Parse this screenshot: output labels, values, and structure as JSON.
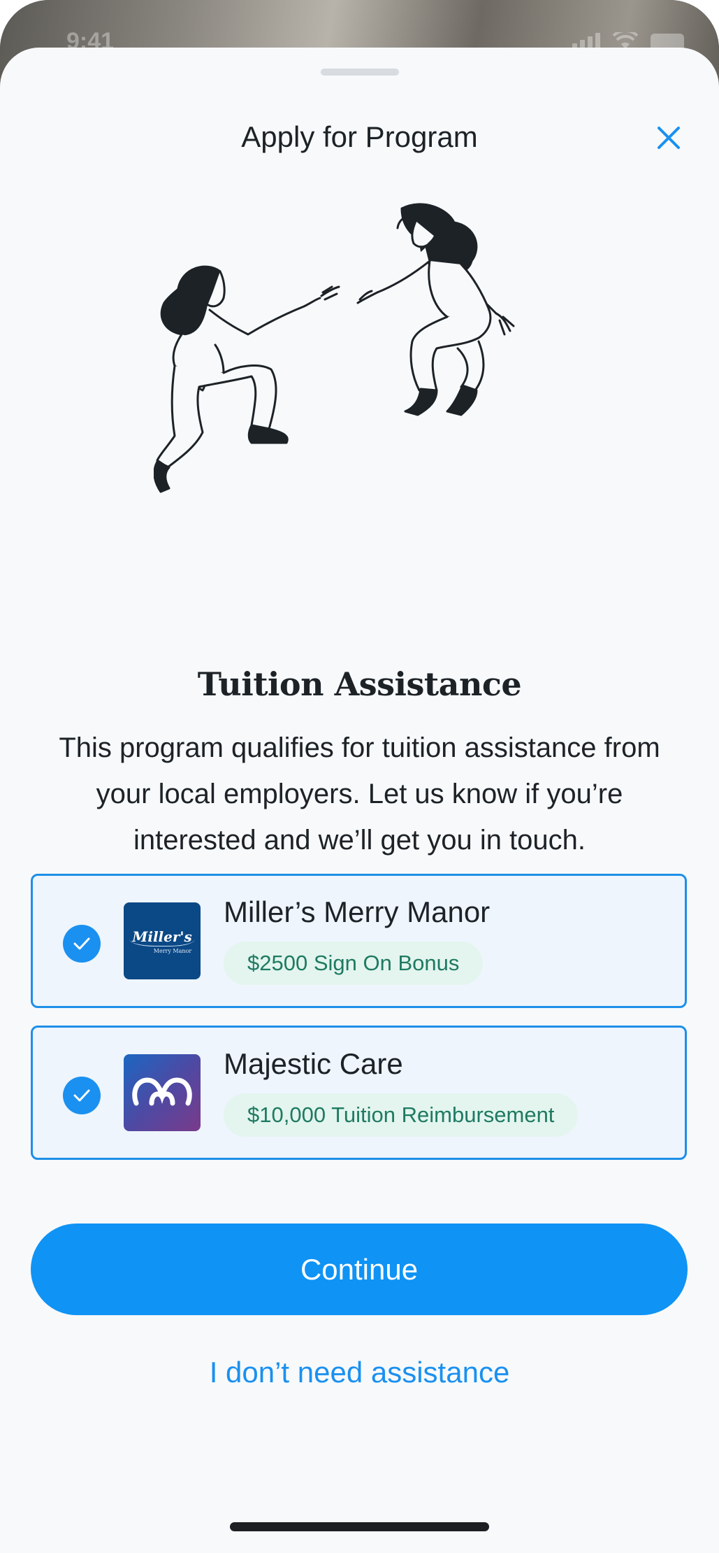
{
  "status_bar": {
    "time": "9:41"
  },
  "header": {
    "title": "Apply for Program",
    "close_icon": "close-icon"
  },
  "illustration": {
    "icon": "two-people-reaching-illustration"
  },
  "content": {
    "heading": "Tuition Assistance",
    "body": "This program qualifies for tuition assistance from your local employers. Let us know if you’re interested and we’ll get you in touch."
  },
  "employers": [
    {
      "name": "Miller’s Merry Manor",
      "benefit": "$2500 Sign On Bonus",
      "selected": true,
      "logo_text": "Miller's",
      "logo_subtext": "Merry Manor",
      "logo_color": "#0b4886"
    },
    {
      "name": "Majestic Care",
      "benefit": "$10,000 Tuition Reimbursement",
      "selected": true,
      "logo_icon": "majestic-care-logo",
      "logo_color": "#4d4aa4"
    }
  ],
  "actions": {
    "continue_label": "Continue",
    "decline_label": "I don’t need assistance"
  },
  "colors": {
    "accent": "#0f93f5",
    "selected_border": "#1e8fe8",
    "pill_bg": "#e3f5ee",
    "pill_text": "#1f7a62",
    "sheet_bg": "#f7f9fb"
  }
}
